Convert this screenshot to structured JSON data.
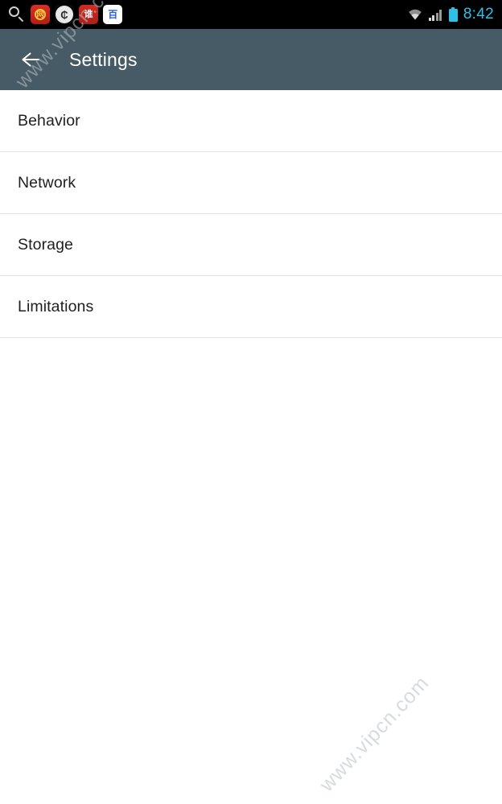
{
  "status_bar": {
    "search_icon": "search-icon",
    "notifications": [
      {
        "name": "notification-icon-red-coin",
        "glyph": "网"
      },
      {
        "name": "notification-icon-white-circle",
        "glyph": "₵"
      },
      {
        "name": "notification-icon-red-chat",
        "glyph": "谁"
      },
      {
        "name": "notification-icon-baidu",
        "glyph": "百"
      }
    ],
    "wifi_icon": "wifi-icon",
    "signal_icon": "cellular-signal-icon",
    "battery_icon": "battery-icon",
    "time": "8:42",
    "accent_color": "#2ec0e8",
    "background_color": "#000000"
  },
  "action_bar": {
    "back_icon": "back-arrow-icon",
    "title": "Settings",
    "background_color": "#465b66",
    "title_color": "#ffffff"
  },
  "settings_list": {
    "items": [
      {
        "label": "Behavior"
      },
      {
        "label": "Network"
      },
      {
        "label": "Storage"
      },
      {
        "label": "Limitations"
      }
    ],
    "divider_color": "#e3e3e3",
    "text_color": "#1f1f1f"
  },
  "watermarks": {
    "top": "www.vipcn.com",
    "bottom": "www.vipcn.com"
  }
}
